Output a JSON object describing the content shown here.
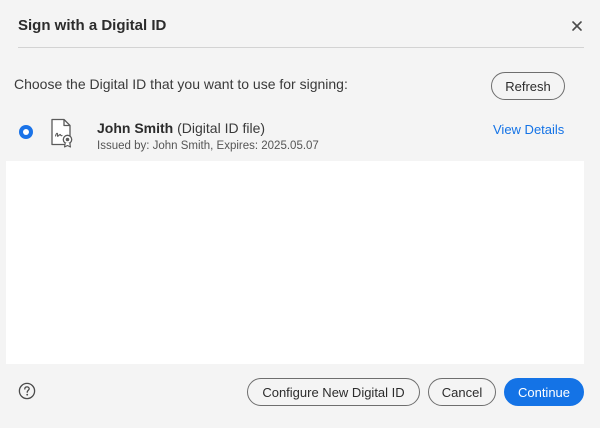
{
  "dialog": {
    "title": "Sign with a Digital ID",
    "close_icon": "close-icon",
    "prompt": "Choose the Digital ID that you want to use for signing:",
    "refresh_label": "Refresh"
  },
  "digital_ids": [
    {
      "selected": true,
      "icon": "certificate-icon",
      "name": "John Smith",
      "type": "(Digital ID file)",
      "meta": "Issued by: John Smith, Expires: 2025.05.07",
      "view_details_label": "View Details"
    }
  ],
  "footer": {
    "help_icon": "help-icon",
    "configure_label": "Configure New Digital ID",
    "cancel_label": "Cancel",
    "continue_label": "Continue"
  },
  "colors": {
    "accent": "#1473e6",
    "background": "#f4f4f4",
    "list_background": "#ffffff"
  }
}
